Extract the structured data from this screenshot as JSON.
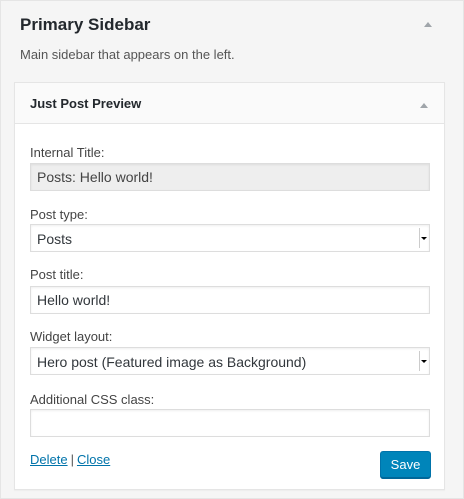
{
  "sidebar": {
    "title": "Primary Sidebar",
    "description": "Main sidebar that appears on the left."
  },
  "widget": {
    "title": "Just Post Preview",
    "fields": {
      "internal_title": {
        "label": "Internal Title:",
        "value": "Posts: Hello world!"
      },
      "post_type": {
        "label": "Post type:",
        "value": "Posts"
      },
      "post_title": {
        "label": "Post title:",
        "value": "Hello world!"
      },
      "widget_layout": {
        "label": "Widget layout:",
        "value": "Hero post (Featured image as Background)"
      },
      "css_class": {
        "label": "Additional CSS class:",
        "value": ""
      }
    },
    "actions": {
      "delete_label": "Delete",
      "separator": "|",
      "close_label": "Close",
      "save_label": "Save"
    }
  },
  "colors": {
    "accent": "#0085ba",
    "link": "#0073aa"
  },
  "icons": {
    "sidebar_toggle": "caret-up-icon",
    "widget_toggle": "caret-up-icon",
    "select_arrow": "dropdown-arrow-icon"
  }
}
